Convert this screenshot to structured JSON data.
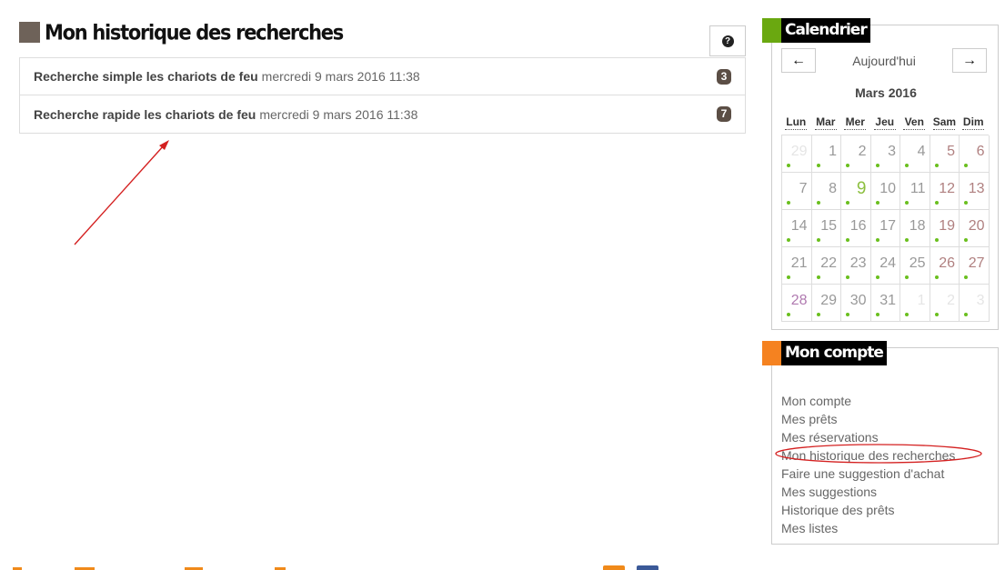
{
  "main": {
    "title": "Mon historique des recherches",
    "help_icon_glyph": "?",
    "history": [
      {
        "query": "Recherche simple les chariots de feu",
        "date": "mercredi 9 mars 2016 11:38",
        "count": "3"
      },
      {
        "query": "Recherche rapide les chariots de feu",
        "date": "mercredi 9 mars 2016 11:38",
        "count": "7"
      }
    ]
  },
  "calendar": {
    "title": "Calendrier",
    "accent_color": "#6aa810",
    "prev_icon": "arrow-left-icon",
    "next_icon": "arrow-right-icon",
    "today_label": "Aujourd'hui",
    "month_label": "Mars 2016",
    "weekdays": [
      "Lun",
      "Mar",
      "Mer",
      "Jeu",
      "Ven",
      "Sam",
      "Dim"
    ],
    "days": [
      {
        "n": "29",
        "cls": "other"
      },
      {
        "n": "1",
        "cls": ""
      },
      {
        "n": "2",
        "cls": ""
      },
      {
        "n": "3",
        "cls": ""
      },
      {
        "n": "4",
        "cls": ""
      },
      {
        "n": "5",
        "cls": "wk"
      },
      {
        "n": "6",
        "cls": "wk"
      },
      {
        "n": "7",
        "cls": ""
      },
      {
        "n": "8",
        "cls": ""
      },
      {
        "n": "9",
        "cls": "today"
      },
      {
        "n": "10",
        "cls": ""
      },
      {
        "n": "11",
        "cls": ""
      },
      {
        "n": "12",
        "cls": "wk"
      },
      {
        "n": "13",
        "cls": "wk"
      },
      {
        "n": "14",
        "cls": ""
      },
      {
        "n": "15",
        "cls": ""
      },
      {
        "n": "16",
        "cls": ""
      },
      {
        "n": "17",
        "cls": ""
      },
      {
        "n": "18",
        "cls": ""
      },
      {
        "n": "19",
        "cls": "wk"
      },
      {
        "n": "20",
        "cls": "wk"
      },
      {
        "n": "21",
        "cls": ""
      },
      {
        "n": "22",
        "cls": ""
      },
      {
        "n": "23",
        "cls": ""
      },
      {
        "n": "24",
        "cls": ""
      },
      {
        "n": "25",
        "cls": ""
      },
      {
        "n": "26",
        "cls": "wk"
      },
      {
        "n": "27",
        "cls": "wk"
      },
      {
        "n": "28",
        "cls": "hl"
      },
      {
        "n": "29",
        "cls": ""
      },
      {
        "n": "30",
        "cls": ""
      },
      {
        "n": "31",
        "cls": ""
      },
      {
        "n": "1",
        "cls": "other"
      },
      {
        "n": "2",
        "cls": "other"
      },
      {
        "n": "3",
        "cls": "other"
      }
    ]
  },
  "account": {
    "title": "Mon compte",
    "accent_color": "#f58220",
    "links": [
      "Mon compte",
      "Mes prêts",
      "Mes réservations",
      "Mon historique des recherches",
      "Faire une suggestion d'achat",
      "Mes suggestions",
      "Historique des prêts",
      "Mes listes"
    ]
  },
  "colors": {
    "title_square": "#6e6259",
    "badge": "#5b4e45",
    "annotation_red": "#d42020",
    "dot_green": "#6abf1e"
  }
}
